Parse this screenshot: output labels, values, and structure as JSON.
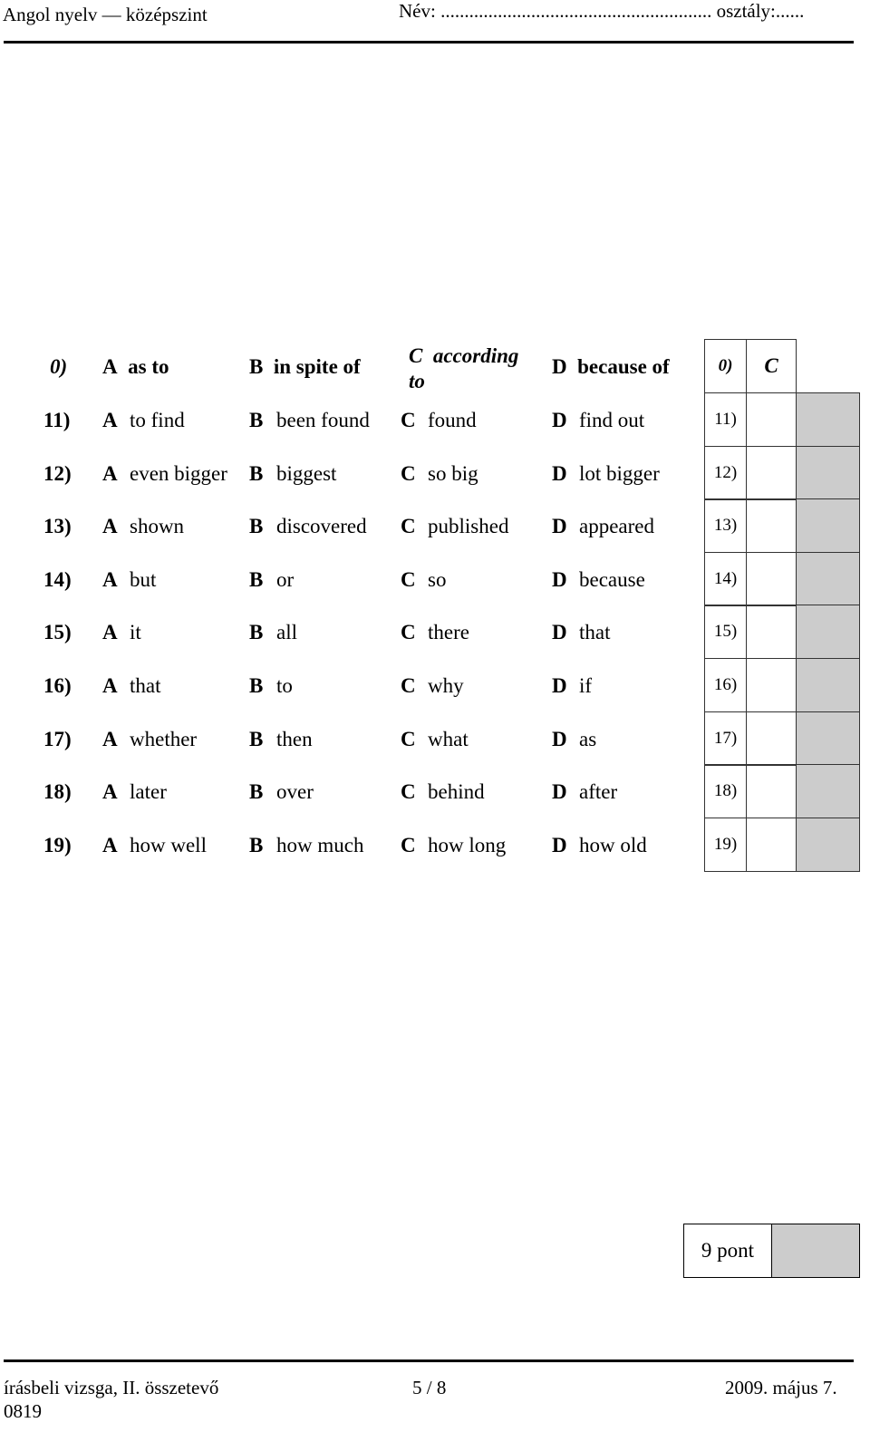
{
  "header": {
    "subject": "Angol nyelv — középszint",
    "name_field": "Név: ......................................................... osztály:......"
  },
  "example": {
    "number": "0)",
    "options": [
      {
        "letter": "A",
        "text": "as to"
      },
      {
        "letter": "B",
        "text": "in spite of"
      },
      {
        "letter": "C",
        "text": "according to"
      },
      {
        "letter": "D",
        "text": "because of"
      }
    ],
    "answer_label": "0)",
    "answer": "C"
  },
  "questions": [
    {
      "number": "11)",
      "options": [
        {
          "letter": "A",
          "text": "to find"
        },
        {
          "letter": "B",
          "text": "been found"
        },
        {
          "letter": "C",
          "text": "found"
        },
        {
          "letter": "D",
          "text": "find out"
        }
      ],
      "label": "11)"
    },
    {
      "number": "12)",
      "options": [
        {
          "letter": "A",
          "text": "even bigger"
        },
        {
          "letter": "B",
          "text": "biggest"
        },
        {
          "letter": "C",
          "text": "so big"
        },
        {
          "letter": "D",
          "text": "lot bigger"
        }
      ],
      "label": "12)"
    },
    {
      "number": "13)",
      "options": [
        {
          "letter": "A",
          "text": "shown"
        },
        {
          "letter": "B",
          "text": "discovered"
        },
        {
          "letter": "C",
          "text": "published"
        },
        {
          "letter": "D",
          "text": "appeared"
        }
      ],
      "label": "13)"
    },
    {
      "number": "14)",
      "options": [
        {
          "letter": "A",
          "text": "but"
        },
        {
          "letter": "B",
          "text": "or"
        },
        {
          "letter": "C",
          "text": "so"
        },
        {
          "letter": "D",
          "text": "because"
        }
      ],
      "label": "14)"
    },
    {
      "number": "15)",
      "options": [
        {
          "letter": "A",
          "text": "it"
        },
        {
          "letter": "B",
          "text": "all"
        },
        {
          "letter": "C",
          "text": "there"
        },
        {
          "letter": "D",
          "text": "that"
        }
      ],
      "label": "15)"
    },
    {
      "number": "16)",
      "options": [
        {
          "letter": "A",
          "text": "that"
        },
        {
          "letter": "B",
          "text": "to"
        },
        {
          "letter": "C",
          "text": "why"
        },
        {
          "letter": "D",
          "text": "if"
        }
      ],
      "label": "16)"
    },
    {
      "number": "17)",
      "options": [
        {
          "letter": "A",
          "text": "whether"
        },
        {
          "letter": "B",
          "text": "then"
        },
        {
          "letter": "C",
          "text": "what"
        },
        {
          "letter": "D",
          "text": "as"
        }
      ],
      "label": "17)"
    },
    {
      "number": "18)",
      "options": [
        {
          "letter": "A",
          "text": "later"
        },
        {
          "letter": "B",
          "text": "over"
        },
        {
          "letter": "C",
          "text": "behind"
        },
        {
          "letter": "D",
          "text": "after"
        }
      ],
      "label": "18)"
    },
    {
      "number": "19)",
      "options": [
        {
          "letter": "A",
          "text": "how well"
        },
        {
          "letter": "B",
          "text": "how much"
        },
        {
          "letter": "C",
          "text": "how long"
        },
        {
          "letter": "D",
          "text": "how old"
        }
      ],
      "label": "19)"
    }
  ],
  "score_box": {
    "label": "9 pont"
  },
  "footer": {
    "left": "írásbeli vizsga, II. összetevő",
    "code": "0819",
    "center": "5 / 8",
    "right": "2009. május 7."
  },
  "colors": {
    "score_cell": "#cccccc",
    "grid_border": "#333333"
  }
}
